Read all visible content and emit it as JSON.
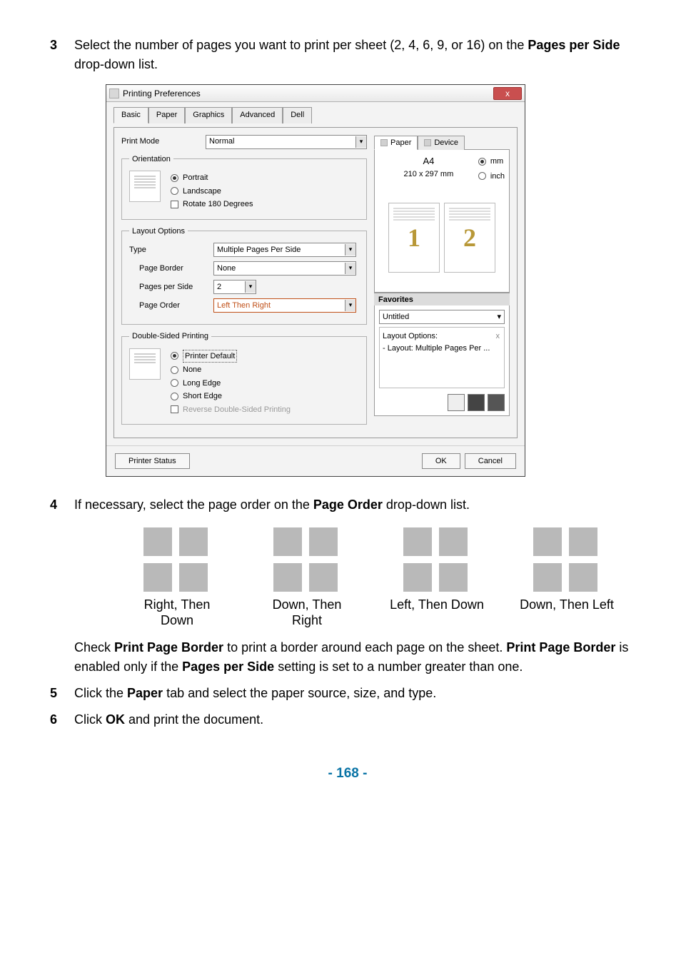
{
  "steps": {
    "s3": {
      "num": "3",
      "pre": "Select the number of pages you want to print per sheet (2, 4, 6, 9, or 16) on the ",
      "b1": "Pages per Side",
      "post": " drop-down list."
    },
    "s4": {
      "num": "4",
      "pre": "If necessary, select the page order on the ",
      "b1": "Page Order",
      "post": " drop-down list."
    },
    "s4ck": {
      "pre": "Check ",
      "b1": "Print Page Border",
      "mid1": " to print a border around each page on the sheet. ",
      "b2": "Print Page Border",
      "mid2": " is enabled only if the ",
      "b3": "Pages per Side",
      "post": " setting is set to a number greater than one."
    },
    "s5": {
      "num": "5",
      "pre": "Click the ",
      "b1": "Paper",
      "post": " tab and select the paper source, size, and type."
    },
    "s6": {
      "num": "6",
      "pre": "Click ",
      "b1": "OK",
      "post": " and print the document."
    }
  },
  "dialog": {
    "title": "Printing Preferences",
    "close": "x",
    "tabs": [
      "Basic",
      "Paper",
      "Graphics",
      "Advanced",
      "Dell"
    ],
    "printmode": {
      "label": "Print Mode",
      "value": "Normal"
    },
    "orientation": {
      "legend": "Orientation",
      "portrait": "Portrait",
      "landscape": "Landscape",
      "rotate": "Rotate 180 Degrees"
    },
    "layout": {
      "legend": "Layout Options",
      "type": {
        "label": "Type",
        "value": "Multiple Pages Per Side"
      },
      "border": {
        "label": "Page Border",
        "value": "None"
      },
      "pps": {
        "label": "Pages per Side",
        "value": "2"
      },
      "order": {
        "label": "Page Order",
        "value": "Left Then Right"
      }
    },
    "duplex": {
      "legend": "Double-Sided Printing",
      "printerdefault": "Printer Default",
      "none": "None",
      "longedge": "Long Edge",
      "shortedge": "Short Edge",
      "reverse": "Reverse Double-Sided Printing"
    },
    "rightpane": {
      "tabs": {
        "paper": "Paper",
        "device": "Device"
      },
      "papername": "A4",
      "papersize": "210 x 297 mm",
      "mm": "mm",
      "inch": "inch",
      "pg1": "1",
      "pg2": "2",
      "fav_hdr": "Favorites",
      "fav_value": "Untitled",
      "fav_line1": "Layout Options:",
      "fav_line2": "- Layout: Multiple Pages Per ...",
      "fav_x": "x"
    },
    "footer": {
      "status": "Printer Status",
      "ok": "OK",
      "cancel": "Cancel"
    }
  },
  "orders": {
    "a": "Right, Then Down",
    "b": "Down, Then Right",
    "c": "Left, Then Down",
    "d": "Down, Then Left"
  },
  "page_number": "- 168 -"
}
